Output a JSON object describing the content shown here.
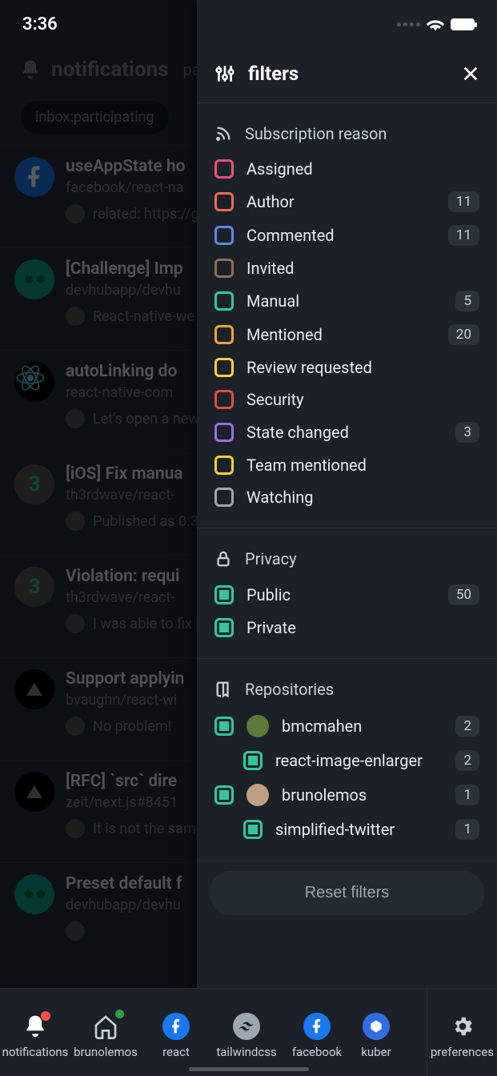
{
  "status": {
    "time": "3:36"
  },
  "header": {
    "title": "notifications",
    "subtitle": "par"
  },
  "chip": "inbox:participating",
  "drawer": {
    "title": "filters",
    "sections": {
      "subscription": {
        "header": "Subscription reason"
      },
      "privacy": {
        "header": "Privacy"
      },
      "repos": {
        "header": "Repositories"
      }
    },
    "sub_reasons": [
      {
        "label": "Assigned",
        "color": "#f05078",
        "count": null
      },
      {
        "label": "Author",
        "color": "#ef6a5a",
        "count": "11"
      },
      {
        "label": "Commented",
        "color": "#5a8ae6",
        "count": "11"
      },
      {
        "label": "Invited",
        "color": "#8c6e54",
        "count": null
      },
      {
        "label": "Manual",
        "color": "#2fc99a",
        "count": "5"
      },
      {
        "label": "Mentioned",
        "color": "#f0a040",
        "count": "20"
      },
      {
        "label": "Review requested",
        "color": "#f0d040",
        "count": null
      },
      {
        "label": "Security",
        "color": "#e34c42",
        "count": null
      },
      {
        "label": "State changed",
        "color": "#9b6ce6",
        "count": "3"
      },
      {
        "label": "Team mentioned",
        "color": "#f0d040",
        "count": null
      },
      {
        "label": "Watching",
        "color": "#9da7b2",
        "count": null
      }
    ],
    "privacy": [
      {
        "label": "Public",
        "color": "#2fc99a",
        "filled": true,
        "count": "50"
      },
      {
        "label": "Private",
        "color": "#2fc99a",
        "filled": true,
        "count": null
      }
    ],
    "repos": [
      {
        "label": "bmcmahen",
        "color": "#2fc99a",
        "filled": true,
        "count": "2",
        "avatar": "#5b7a3a",
        "indent": false
      },
      {
        "label": "react-image-enlarger",
        "color": "#2fc99a",
        "filled": true,
        "count": "2",
        "avatar": null,
        "indent": true
      },
      {
        "label": "brunolemos",
        "color": "#2fc99a",
        "filled": true,
        "count": "1",
        "avatar": "#c0a080",
        "indent": false
      },
      {
        "label": "simplified-twitter",
        "color": "#2fc99a",
        "filled": true,
        "count": "1",
        "avatar": null,
        "indent": true
      }
    ],
    "reset": "Reset filters"
  },
  "notifications": [
    {
      "title": "useAppState ho",
      "repo": "facebook/react-na",
      "sub": "related: https://g",
      "av": "fb"
    },
    {
      "title": "[Challenge] Imp",
      "repo": "devhubapp/devhu",
      "sub": "React-native-we",
      "av": "devhub"
    },
    {
      "title": "autoLinking do",
      "repo": "react-native-com",
      "sub": "Let's open a new",
      "av": "react"
    },
    {
      "title": "[iOS] Fix manua",
      "repo": "th3rdwave/react-",
      "sub": "Published as 0.3",
      "av": "th3"
    },
    {
      "title": "Violation: requi",
      "repo": "th3rdwave/react-",
      "sub": "I was able to fix i",
      "av": "th3"
    },
    {
      "title": "Support applyin",
      "repo": "bvaughn/react-wi",
      "sub": "No problem!",
      "av": "dark"
    },
    {
      "title": "[RFC] `src` dire",
      "repo": "zeit/next.js#8451",
      "sub": "It is not the same",
      "av": "dark"
    },
    {
      "title": "Preset default f",
      "repo": "devhubapp/devhu",
      "sub": "",
      "av": "devhub"
    }
  ],
  "tabs": [
    {
      "label": "notifications",
      "kind": "bell"
    },
    {
      "label": "brunolemos",
      "kind": "home"
    },
    {
      "label": "react",
      "kind": "fb"
    },
    {
      "label": "tailwindcss",
      "kind": "tw"
    },
    {
      "label": "facebook",
      "kind": "fb"
    },
    {
      "label": "kuber",
      "kind": "kube"
    },
    {
      "label": "preferences",
      "kind": "gear"
    }
  ]
}
